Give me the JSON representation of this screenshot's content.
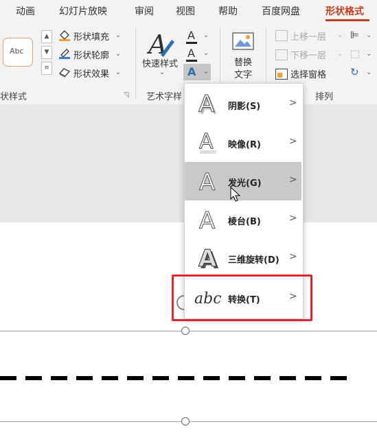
{
  "tabs": [
    {
      "label": "动画"
    },
    {
      "label": "幻灯片放映"
    },
    {
      "label": "审阅"
    },
    {
      "label": "视图"
    },
    {
      "label": "帮助"
    },
    {
      "label": "百度网盘"
    },
    {
      "label": "形状格式"
    }
  ],
  "ribbon": {
    "shape_style_preview": "Abc",
    "shape_fill": "形状填充",
    "shape_outline": "形状轮廓",
    "shape_effects": "形状效果",
    "shape_styles_group": "状样式",
    "quick_styles": "快速样式",
    "art_text_group": "艺术字样",
    "alt_text_line1": "替换",
    "alt_text_line2": "文字",
    "bring_forward": "上移一层",
    "send_backward": "下移一层",
    "selection_pane": "选择窗格",
    "arrange_group": "排列"
  },
  "text_effects_menu": {
    "items": [
      {
        "label": "阴影(S)",
        "icon": "shadow-a-icon"
      },
      {
        "label": "映像(R)",
        "icon": "reflection-a-icon"
      },
      {
        "label": "发光(G)",
        "icon": "glow-a-icon"
      },
      {
        "label": "棱台(B)",
        "icon": "bevel-a-icon"
      },
      {
        "label": "三维旋转(D)",
        "icon": "3d-rotation-a-icon"
      },
      {
        "label": "转换(T)",
        "icon": "transform-abc-icon"
      }
    ],
    "hover_index": 2
  },
  "colors": {
    "accent": "#c43e1c",
    "highlight_box": "#e0252b",
    "menu_hover": "#c9c9c9"
  }
}
